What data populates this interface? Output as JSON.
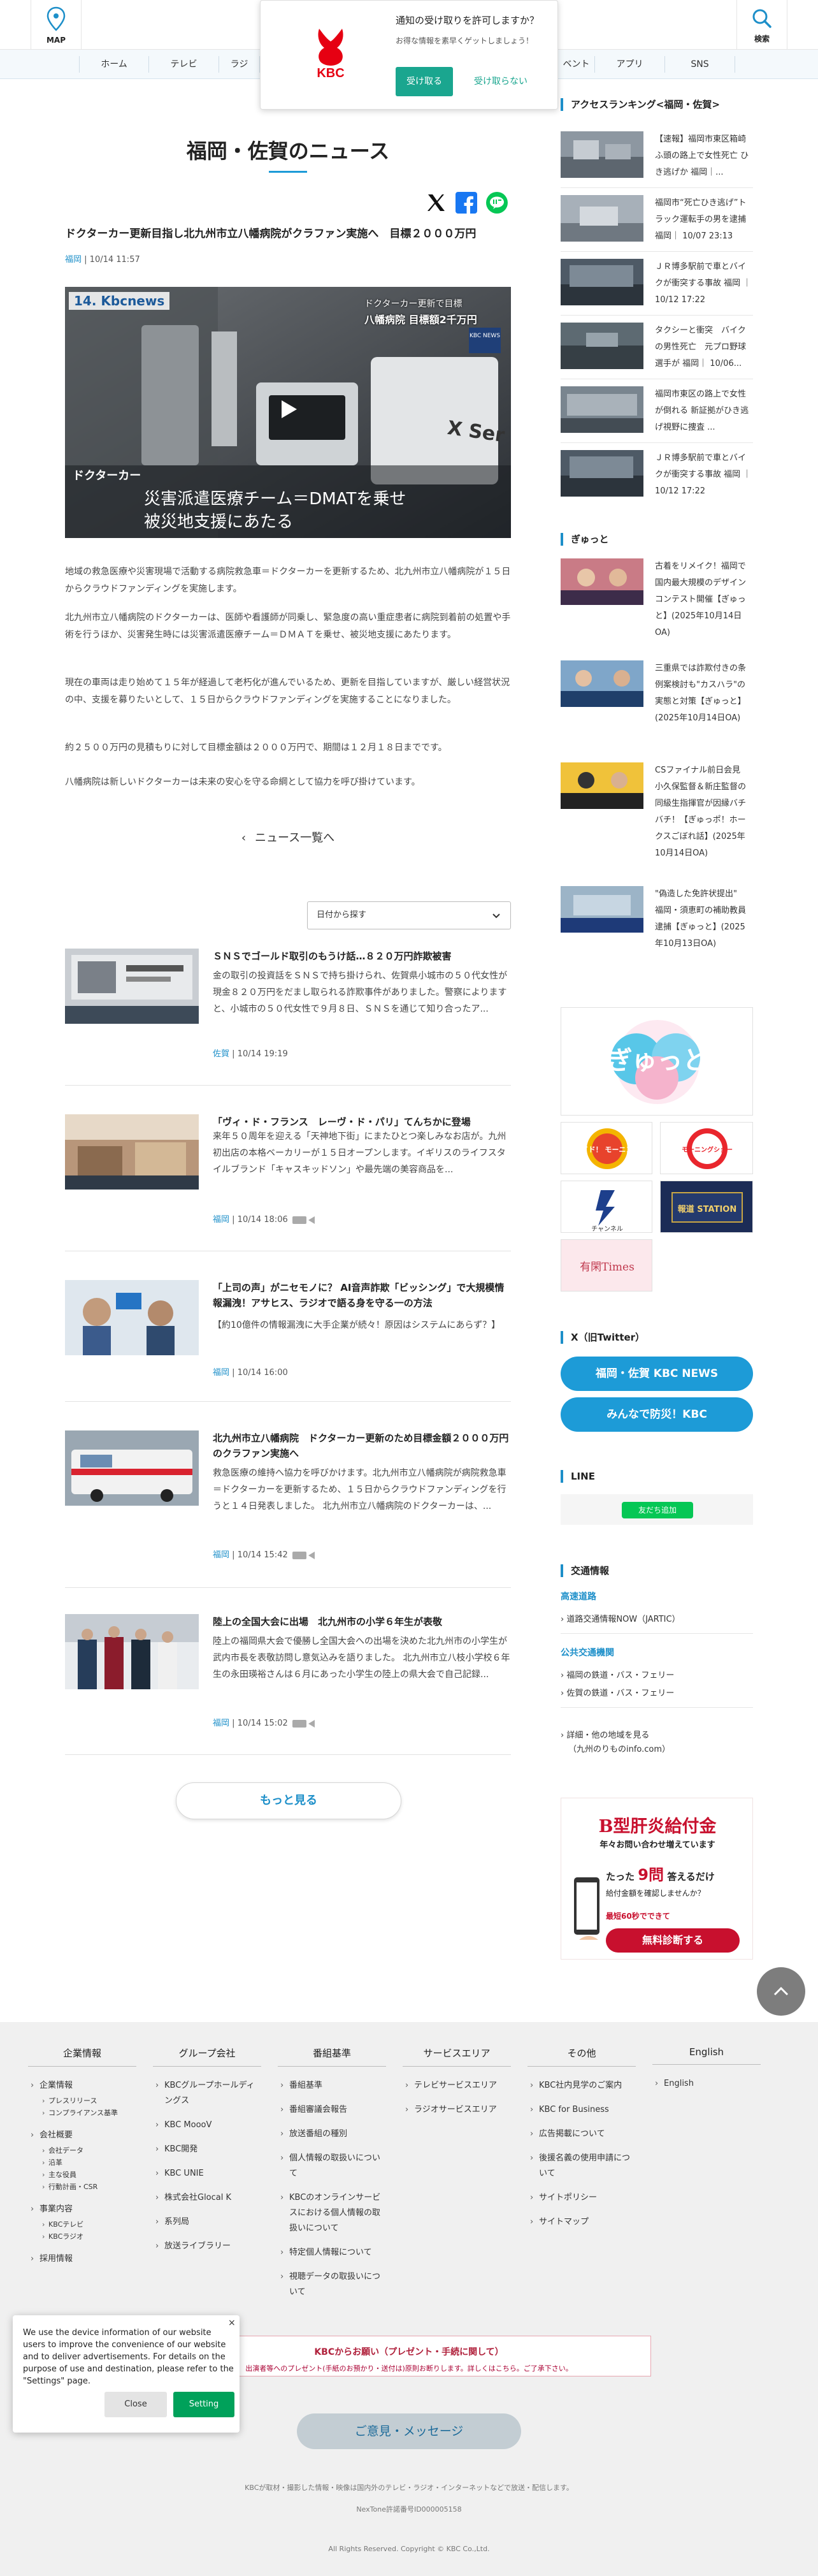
{
  "header": {
    "map_label": "MAP",
    "search_label": "検索",
    "nav": [
      "ホーム",
      "テレビ",
      "ラジ",
      "ベント",
      "アプリ",
      "SNS"
    ]
  },
  "notification": {
    "line1": "通知の受け取りを許可しますか？",
    "line2": "お得な情報を素早くゲットしましょう！",
    "accept": "受け取る",
    "reject": "受け取らない",
    "logo_text": "KBC"
  },
  "main": {
    "page_title": "福岡・佐賀のニュース",
    "article": {
      "title": "ドクターカー更新目指し北九州市立八幡病院がクラファン実施へ　目標２０００万円",
      "category": "福岡",
      "date": "10/14 11:57",
      "video": {
        "channel_badge": "14. Kbcnews",
        "overlay_top1": "ドクターカー更新で目標",
        "overlay_top2": "八幡病院 目標額2千万円",
        "live_badge": "KBC NEWS",
        "label": "ドクターカー",
        "caption1": "災害派遣医療チーム＝DMATを乗せ",
        "caption2": "被災地支援にあたる",
        "side_text": "X Ser"
      },
      "paragraphs": [
        "地域の救急医療や災害現場で活動する病院救急車＝ドクターカーを更新するため、北九州市立八幡病院が１５日からクラウドファンディングを実施します。",
        "北九州市立八幡病院のドクターカーは、医師や看護師が同乗し、緊急度の高い重症患者に病院到着前の処置や手術を行うほか、災害発生時には災害派遣医療チーム＝ＤＭＡＴを乗せ、被災地支援にあたります。",
        "現在の車両は走り始めて１５年が経過して老朽化が進んでいるため、更新を目指していますが、厳しい経営状況の中、支援を募りたいとして、１５日からクラウドファンディングを実施することになりました。",
        "約２５００万円の見積もりに対して目標金額は２０００万円で、期間は１２月１８日までです。",
        "八幡病院は新しいドクターカーは未来の安心を守る命綱として協力を呼び掛けています。"
      ]
    },
    "back_link": "ニュース一覧へ",
    "date_select": "日付から探す",
    "news": [
      {
        "title": "ＳＮＳでゴールド取引のもうけ話…８２０万円詐欺被害",
        "excerpt": "金の取引の投資話をＳＮＳで持ち掛けられ、佐賀県小城市の５０代女性が現金８２０万円をだまし取られる詐欺事件がありました。警察によりますと、小城市の５０代女性で９月８日、ＳＮＳを通じて知り合ったア...",
        "category": "佐賀",
        "date": "10/14 19:19",
        "video": false
      },
      {
        "title": "「ヴィ・ド・フランス　レーヴ・ド・パリ」てんちかに登場",
        "excerpt": "来年５０周年を迎える「天神地下街」にまたひとつ楽しみなお店が。九州初出店の本格ベーカリーが１５日オープンします。イギリスのライフスタイルブランド「キャスキッドソン」や最先端の美容商品を...",
        "category": "福岡",
        "date": "10/14 18:06",
        "video": true
      },
      {
        "title": "「上司の声」がニセモノに？ AI音声詐欺「ビッシング」で大規模情報漏洩！アサヒス、ラジオで語る身を守る一の方法",
        "excerpt": "【約10億件の情報漏洩に大手企業が続々！原因はシステムにあらず？】",
        "category": "福岡",
        "date": "10/14 16:00",
        "video": false
      },
      {
        "title": "北九州市立八幡病院　ドクターカー更新のため目標金額２０００万円のクラファン実施へ",
        "excerpt": "救急医療の維持へ協力を呼びかけます。北九州市立八幡病院が病院救急車＝ドクターカーを更新するため、１５日からクラウドファンディングを行うと１４日発表しました。 北九州市立八幡病院のドクターカーは、...",
        "category": "福岡",
        "date": "10/14 15:42",
        "video": true
      },
      {
        "title": "陸上の全国大会に出場　北九州市の小学６年生が表敬",
        "excerpt": "陸上の福岡県大会で優勝し全国大会への出場を決めた北九州市の小学生が武内市長を表敬訪問し意気込みを語りました。 北九州市立八枝小学校６年生の永田瑛裕さんは６月にあった小学生の陸上の県大会で自己記録...",
        "category": "福岡",
        "date": "10/14 15:02",
        "video": true
      }
    ],
    "more_button": "もっと見る"
  },
  "sidebar": {
    "ranking_heading": "アクセスランキング<福岡・佐賀>",
    "ranking": [
      "【速報】福岡市東区箱崎ふ頭の路上で女性死亡 ひき逃げか 福岡｜...",
      "福岡市“死亡ひき逃げ”トラック運転手の男を逮捕 福岡｜ 10/07 23:13",
      "ＪＲ博多駅前で車とバイクが衝突する事故 福岡 ｜ 10/12 17:22",
      "タクシーと衝突　バイクの男性死亡　元プロ野球選手が 福岡｜ 10/06...",
      "福岡市東区の路上で女性が倒れる 新証拠がひき逃げ視野に捜査 ...",
      "ＪＲ博多駅前で車とバイクが衝突する事故 福岡 ｜ 10/12 17:22"
    ],
    "gyutto_heading": "ぎゅっと",
    "gyutto": [
      "古着をリメイク！福岡で国内最大規模のデザインコンテスト開催【ぎゅっと】(2025年10月14日OA)",
      "三重県では詐欺付きの条例案検討も\"カスハラ\"の実態と対策【ぎゅっと】(2025年10月14日OA)",
      "CSファイナル前日会見　小久保監督＆新庄監督の同級生指揮官が因縁バチバチ！【ぎゅっポ！ホークスごぼれ話】(2025年10月14日OA)",
      "\"偽造した免許状提出\"　福岡・須恵町の補助教員逮捕【ぎゅっと】(2025年10月13日OA)"
    ],
    "banners": {
      "gyutto_logo": "ぎゅっと",
      "wide": "ワイド！ モーニング",
      "morning": "モーニングショー",
      "channel": "チャンネル",
      "station": "報道 STATION",
      "yukan": "有閑Times"
    },
    "twitter_heading": "X（旧Twitter）",
    "twitter_buttons": [
      "福岡・佐賀 KBC NEWS",
      "みんなで防災！KBC"
    ],
    "line_heading": "LINE",
    "line_add": "友だち追加",
    "traffic_heading": "交通情報",
    "traffic_sub1": "高速道路",
    "traffic_link1": "道路交通情報NOW（JARTIC）",
    "traffic_sub2": "公共交通機関",
    "traffic_link2": "福岡の鉄道・バス・フェリー",
    "traffic_link3": "佐賀の鉄道・バス・フェリー",
    "traffic_link4a": "詳細・他の地域を見る",
    "traffic_link4b": "（九州のりものinfo.com）",
    "ad": {
      "title": "B型肝炎給付金",
      "sub": "年々お問い合わせ増えています",
      "q1": "たった",
      "q2": "9問",
      "q3": "答えるだけ",
      "q4": "給付金額を確認しませんか？",
      "q5": "最短60秒でできて",
      "btn": "無料診断する"
    }
  },
  "footer": {
    "cols": [
      {
        "head": "企業情報",
        "items": [
          "企業情報",
          "会社概要",
          "事業内容",
          "採用情報"
        ],
        "subs": {
          "0": [
            "プレスリリース",
            "コンプライアンス基準"
          ],
          "1": [
            "会社データ",
            "沿革",
            "主な役員",
            "行動計画・CSR"
          ],
          "2": [
            "KBCテレビ",
            "KBCラジオ"
          ]
        }
      },
      {
        "head": "グループ会社",
        "items": [
          "KBCグループホールディングス",
          "KBC MoooV",
          "KBC開発",
          "KBC UNIE",
          "株式会社Glocal K",
          "系列局",
          "放送ライブラリー"
        ]
      },
      {
        "head": "番組基準",
        "items": [
          "番組基準",
          "番組審議会報告",
          "放送番組の種別",
          "個人情報の取扱いについて",
          "KBCのオンラインサービスにおける個人情報の取扱いについて",
          "特定個人情報について",
          "視聴データの取扱いについて"
        ]
      },
      {
        "head": "サービスエリア",
        "items": [
          "テレビサービスエリア",
          "ラジオサービスエリア"
        ]
      },
      {
        "head": "その他",
        "items": [
          "KBC社内見学のご案内",
          "KBC for Business",
          "広告掲載について",
          "後援名義の使用申請について",
          "サイトポリシー",
          "サイトマップ"
        ]
      },
      {
        "head": "English",
        "items": [
          "English"
        ]
      }
    ],
    "request_title": "KBCからお願い（プレゼント・手続に関して）",
    "request_text": "出演者等へのプレゼント(手紙のお預かり・送付は)原則お断りします。詳しくはこちら。ご了承下さい。",
    "opinion": "ご意見・メッセージ",
    "notice": "KBCが取材・撮影した情報・映像は国内外のテレビ・ラジオ・インターネットなどで放送・配信します。",
    "nextone": "NexTone許諾番号ID000005158",
    "copyright": "All Rights Reserved. Copyright © KBC Co.,Ltd."
  },
  "cookie": {
    "text": "We use the device information of our website users to improve the convenience of our website and to deliver advertisements. For details on the purpose of use and destination, please refer to the \"Settings\" page.",
    "close": "Close",
    "setting": "Setting"
  }
}
